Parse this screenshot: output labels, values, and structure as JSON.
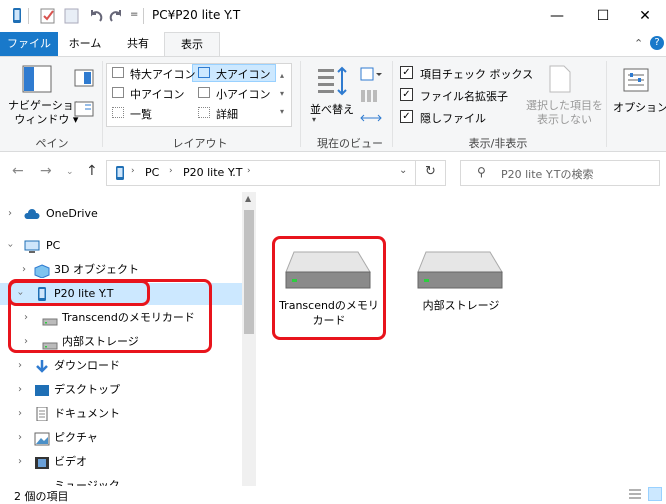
{
  "window": {
    "title": "PC¥P20 lite Y.T"
  },
  "quick_access": {
    "dropdown_label": "="
  },
  "window_controls": {
    "minimize": "—",
    "maximize": "☐",
    "close": "✕"
  },
  "tabs": [
    {
      "label": "ファイル"
    },
    {
      "label": "ホーム"
    },
    {
      "label": "共有"
    },
    {
      "label": "表示"
    }
  ],
  "ribbon": {
    "pane": {
      "nav_pane_label": "ナビゲーション\nウィンドウ ▾",
      "group": "ペイン"
    },
    "layout": {
      "items": [
        "特大アイコン",
        "大アイコン",
        "中アイコン",
        "小アイコン",
        "一覧",
        "詳細"
      ],
      "group": "レイアウト"
    },
    "current_view": {
      "sort_label": "並べ替え",
      "group": "現在のビュー"
    },
    "show_hide": {
      "item_checkbox": "項目チェック ボックス",
      "extensions": "ファイル名拡張子",
      "hidden_items": "隠しファイル",
      "hide_selected": "選択した項目を\n表示しない",
      "group": "表示/非表示"
    },
    "options": {
      "label": "オプション"
    }
  },
  "address": {
    "breadcrumb": [
      "PC",
      "P20 lite Y.T"
    ],
    "search_placeholder": "P20 lite Y.Tの検索"
  },
  "nav_tree": [
    {
      "label": "OneDrive"
    },
    {
      "label": "PC"
    },
    {
      "label": "3D オブジェクト"
    },
    {
      "label": "P20 lite Y.T"
    },
    {
      "label": "Transcendのメモリカード"
    },
    {
      "label": "内部ストレージ"
    },
    {
      "label": "ダウンロード"
    },
    {
      "label": "デスクトップ"
    },
    {
      "label": "ドキュメント"
    },
    {
      "label": "ピクチャ"
    },
    {
      "label": "ビデオ"
    },
    {
      "label": "ミュージック"
    }
  ],
  "content": {
    "items": [
      {
        "label": "Transcendのメモリ\nカード"
      },
      {
        "label": "内部ストレージ"
      }
    ]
  },
  "status": {
    "count": "2 個の項目"
  },
  "accent": {
    "file_tab": "#1979ca",
    "highlight": "#e8141c",
    "selected": "#cce8ff"
  }
}
